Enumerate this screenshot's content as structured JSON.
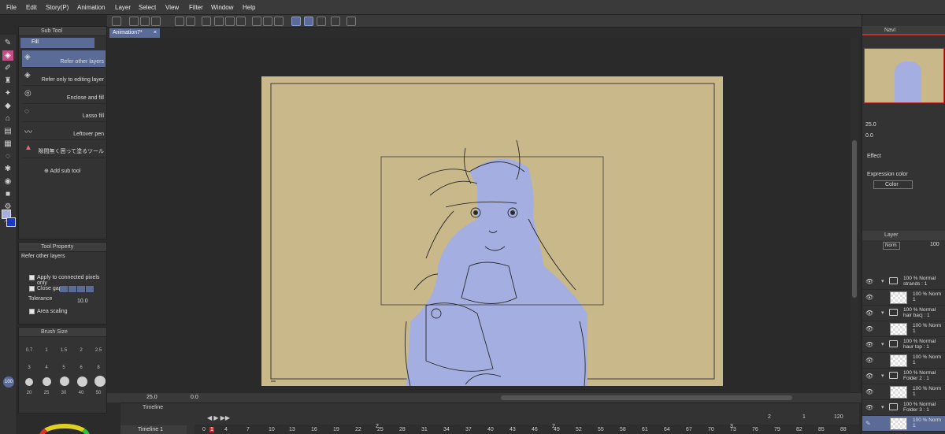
{
  "menu": [
    "File",
    "Edit",
    "Story(P)",
    "Animation",
    "Layer",
    "Select",
    "View",
    "Filter",
    "Window",
    "Help"
  ],
  "document_tab": {
    "label": "Animation7*",
    "close": "×"
  },
  "subtool": {
    "header": "Sub Tool",
    "group": "Fill",
    "items": [
      "Refer other layers",
      "Refer only to editing layer",
      "Enclose and fill",
      "Lasso fill",
      "Leftover pen",
      "隙間無く囲って塗るツール"
    ],
    "add_label": "Add sub tool"
  },
  "tool_property": {
    "header": "Tool Property",
    "title": "Refer other layers",
    "apply_connected": "Apply to connected pixels only",
    "close_gap": "Close gap",
    "tolerance_label": "Tolerance",
    "tolerance_value": "10.0",
    "area_scaling": "Area scaling"
  },
  "brush_size": {
    "header": "Brush Size",
    "sizes": [
      "0.7",
      "1",
      "1.5",
      "2",
      "2.5",
      "3",
      "4",
      "5",
      "6",
      "8",
      "10",
      "12",
      "15",
      "17",
      "20",
      "25",
      "30",
      "40",
      "50"
    ],
    "opacity_label": "100"
  },
  "statusbar": {
    "zoom": "25.0",
    "angle": "0.0"
  },
  "timeline": {
    "header": "Timeline",
    "name": "Timeline 1",
    "counters": [
      "2",
      "1",
      "120"
    ],
    "frames": [
      "0",
      "1",
      "4",
      "7",
      "10",
      "13",
      "16",
      "19",
      "22",
      "25",
      "28",
      "31",
      "34",
      "37",
      "40",
      "43",
      "46",
      "49",
      "52",
      "55",
      "58",
      "61",
      "64",
      "67",
      "70",
      "73",
      "76",
      "79",
      "82",
      "85",
      "88"
    ],
    "markers": [
      "2",
      "2",
      "3"
    ]
  },
  "navigator": {
    "header": "Navi",
    "zoom": "25.0",
    "angle": "0.0"
  },
  "property_panel": {
    "effect_label": "Effect",
    "expression_label": "Expression color",
    "expression_value": "Color"
  },
  "layer_panel": {
    "header": "Layer",
    "blend_mode": "Norm",
    "opacity": "100",
    "layers": [
      {
        "line1": "100 % Normal",
        "line2": "strands : 1",
        "kind": "folder"
      },
      {
        "line1": "100 % Norm",
        "line2": "1",
        "kind": "layer"
      },
      {
        "line1": "100 % Normal",
        "line2": "hair bacj : 1",
        "kind": "folder"
      },
      {
        "line1": "100 % Norm",
        "line2": "1",
        "kind": "layer"
      },
      {
        "line1": "100 % Normal",
        "line2": "haur top : 1",
        "kind": "folder"
      },
      {
        "line1": "100 % Norm",
        "line2": "1",
        "kind": "layer"
      },
      {
        "line1": "100 % Normal",
        "line2": "Folder 2 : 1",
        "kind": "folder"
      },
      {
        "line1": "100 % Norm",
        "line2": "1",
        "kind": "layer"
      },
      {
        "line1": "100 % Normal",
        "line2": "Folder 3 : 1",
        "kind": "folder"
      },
      {
        "line1": "100 % Norm",
        "line2": "1",
        "kind": "layer"
      }
    ]
  },
  "colors": {
    "canvas_bg": "#c9b98a",
    "fill_color": "#a4aee0",
    "accent": "#5b6b98",
    "active_tool": "#c24f86",
    "main_color": "#1a39c8"
  }
}
